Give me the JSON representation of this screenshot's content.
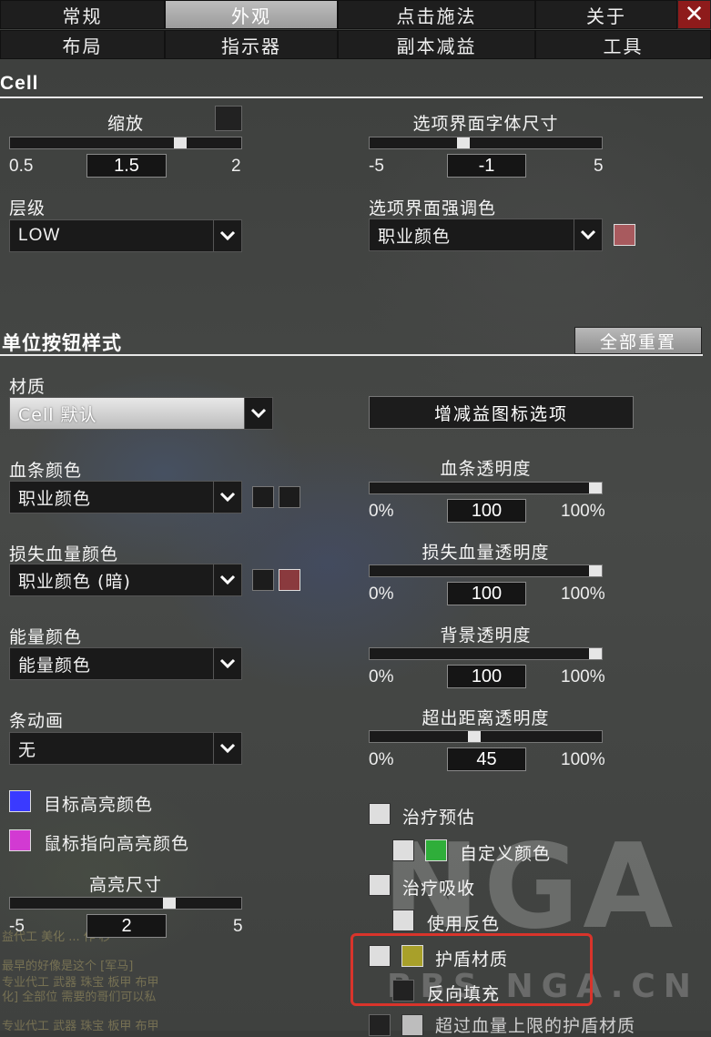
{
  "tabs_row1": [
    "常规",
    "外观",
    "点击施法",
    "关于"
  ],
  "tabs_row2": [
    "布局",
    "指示器",
    "副本减益",
    "工具"
  ],
  "close_label": "✕",
  "cell": {
    "title": "Cell",
    "scale": {
      "label": "缩放",
      "min": "0.5",
      "max": "2",
      "value": "1.5",
      "fraction": 0.75
    },
    "font_size": {
      "label": "选项界面字体尺寸",
      "min": "-5",
      "max": "5",
      "value": "-1",
      "fraction": 0.4
    },
    "strata": {
      "label": "层级",
      "value": "LOW"
    },
    "accent": {
      "label": "选项界面强调色",
      "value": "职业颜色",
      "color": "#a85a5e"
    }
  },
  "unit": {
    "title": "单位按钮样式",
    "reset_all": "全部重置",
    "texture": {
      "label": "材质",
      "value": "Cell 默认"
    },
    "aura_button": "增减益图标选项",
    "health_color": {
      "label": "血条颜色",
      "value": "职业颜色"
    },
    "health_alpha": {
      "label": "血条透明度",
      "min": "0%",
      "max": "100%",
      "value": "100",
      "fraction": 1.0
    },
    "loss_color": {
      "label": "损失血量颜色",
      "value": "职业颜色 (暗)",
      "swatch": "#8a3a3e"
    },
    "loss_alpha": {
      "label": "损失血量透明度",
      "min": "0%",
      "max": "100%",
      "value": "100",
      "fraction": 1.0
    },
    "power_color": {
      "label": "能量颜色",
      "value": "能量颜色"
    },
    "bg_alpha": {
      "label": "背景透明度",
      "min": "0%",
      "max": "100%",
      "value": "100",
      "fraction": 1.0
    },
    "bar_anim": {
      "label": "条动画",
      "value": "无"
    },
    "oor_alpha": {
      "label": "超出距离透明度",
      "min": "0%",
      "max": "100%",
      "value": "45",
      "fraction": 0.45
    },
    "target_highlight": {
      "label": "目标高亮颜色",
      "color": "#3a3aff"
    },
    "mouseover_highlight": {
      "label": "鼠标指向高亮颜色",
      "color": "#d23ad2"
    },
    "highlight_size": {
      "label": "高亮尺寸",
      "min": "-5",
      "max": "5",
      "value": "2",
      "fraction": 0.7
    },
    "heal_prediction": {
      "label": "治疗预估"
    },
    "custom_color": {
      "label": "自定义颜色",
      "color": "#2fae3a"
    },
    "heal_absorb": {
      "label": "治疗吸收"
    },
    "invert_color": {
      "label": "使用反色"
    },
    "shield_texture": {
      "label": "护盾材质",
      "color": "#a8a02a"
    },
    "reverse_fill": {
      "label": "反向填充"
    },
    "overshield": {
      "label": "超过血量上限的护盾材质"
    }
  },
  "watermark": {
    "logo": "NGA",
    "url": "BBS.NGA.CN"
  },
  "bg_chat": [
    "益代工 美化 ...   作  秒",
    "最早的好像是这个 [军马]",
    "专业代工 武器 珠宝 板甲 布甲",
    "化] 全部位 需要的哥们可以私",
    "专业代工 武器 珠宝 板甲 布甲"
  ]
}
